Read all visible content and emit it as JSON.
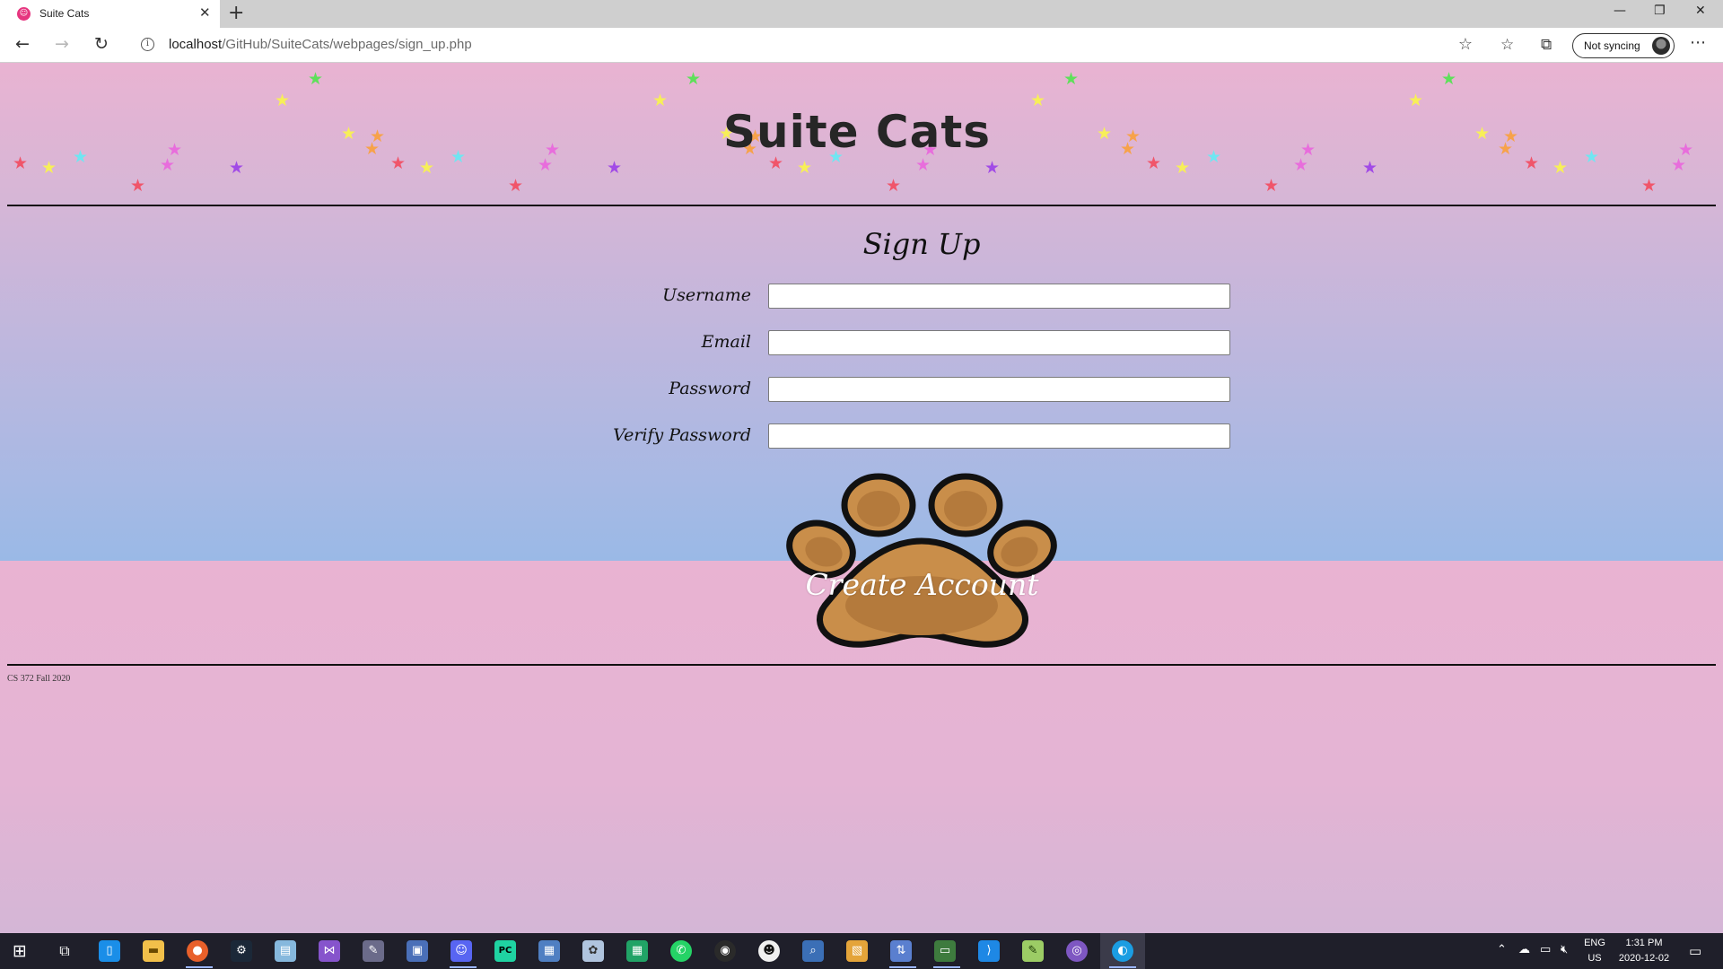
{
  "browser": {
    "tab_title": "Suite Cats",
    "url_host": "localhost",
    "url_path": "/GitHub/SuiteCats/webpages/sign_up.php",
    "sync_label": "Not syncing"
  },
  "page": {
    "site_title": "Suite Cats",
    "form_title": "Sign Up",
    "fields": [
      {
        "label": "Username",
        "value": ""
      },
      {
        "label": "Email",
        "value": ""
      },
      {
        "label": "Password",
        "value": ""
      },
      {
        "label": "Verify Password",
        "value": ""
      }
    ],
    "submit_label": "Create Account",
    "footer": "CS 372 Fall 2020"
  },
  "colors": {
    "background_top": "#e9b3d2",
    "background_bottom": "#9ab9e6",
    "paw_fill": "#c98e4a",
    "paw_outline": "#111111",
    "star_red": "#f0556a",
    "star_yellow": "#f7ef58",
    "star_cyan": "#6fe6f2",
    "star_magenta": "#e86ddc",
    "star_purple": "#a14be6",
    "star_orange": "#f7a24a",
    "star_green": "#5ee05a"
  },
  "taskbar": {
    "language": "ENG",
    "region": "US",
    "time": "1:31 PM",
    "date": "2020-12-02"
  }
}
